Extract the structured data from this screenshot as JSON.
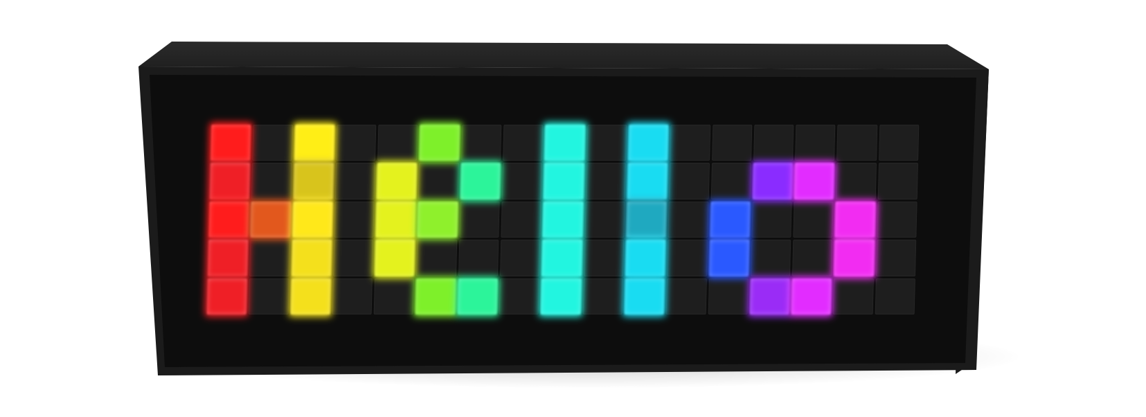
{
  "sign": {
    "grid": {
      "columns": 17,
      "rows": 5
    },
    "body_color": "#1a1a1a",
    "face_color": "#0d0d0d",
    "off_pixel_color": "#1e1e1e",
    "lit_pixels": [
      {
        "col": 0,
        "row": 0,
        "color": "#ff1c1c"
      },
      {
        "col": 0,
        "row": 1,
        "color": "#ef1f26"
      },
      {
        "col": 0,
        "row": 2,
        "color": "#ff1c1c"
      },
      {
        "col": 0,
        "row": 3,
        "color": "#ef1f26"
      },
      {
        "col": 0,
        "row": 4,
        "color": "#ef1f26"
      },
      {
        "col": 1,
        "row": 2,
        "color": "#e2581d"
      },
      {
        "col": 2,
        "row": 0,
        "color": "#ffee16"
      },
      {
        "col": 2,
        "row": 1,
        "color": "#d8c41c"
      },
      {
        "col": 2,
        "row": 2,
        "color": "#ffe81a"
      },
      {
        "col": 2,
        "row": 3,
        "color": "#f4e01c"
      },
      {
        "col": 2,
        "row": 4,
        "color": "#f4e01c"
      },
      {
        "col": 4,
        "row": 1,
        "color": "#e4f21e"
      },
      {
        "col": 4,
        "row": 2,
        "color": "#e4f21e"
      },
      {
        "col": 4,
        "row": 3,
        "color": "#e4f21e"
      },
      {
        "col": 5,
        "row": 0,
        "color": "#7ef02a"
      },
      {
        "col": 5,
        "row": 2,
        "color": "#8ff02c"
      },
      {
        "col": 5,
        "row": 4,
        "color": "#7ef02a"
      },
      {
        "col": 6,
        "row": 1,
        "color": "#2cf49a"
      },
      {
        "col": 6,
        "row": 4,
        "color": "#2cf49a"
      },
      {
        "col": 8,
        "row": 0,
        "color": "#22f5e0"
      },
      {
        "col": 8,
        "row": 1,
        "color": "#22f5e0"
      },
      {
        "col": 8,
        "row": 2,
        "color": "#22f5e0"
      },
      {
        "col": 8,
        "row": 3,
        "color": "#22f5e0"
      },
      {
        "col": 8,
        "row": 4,
        "color": "#22f5e0"
      },
      {
        "col": 10,
        "row": 0,
        "color": "#19dcf2"
      },
      {
        "col": 10,
        "row": 1,
        "color": "#19dcf2"
      },
      {
        "col": 10,
        "row": 2,
        "color": "#1fa9c0"
      },
      {
        "col": 10,
        "row": 3,
        "color": "#19dcf2"
      },
      {
        "col": 10,
        "row": 4,
        "color": "#19dcf2"
      },
      {
        "col": 12,
        "row": 2,
        "color": "#2a59ff"
      },
      {
        "col": 12,
        "row": 3,
        "color": "#2a59ff"
      },
      {
        "col": 13,
        "row": 1,
        "color": "#8a2cff"
      },
      {
        "col": 13,
        "row": 4,
        "color": "#9a2cf6"
      },
      {
        "col": 14,
        "row": 1,
        "color": "#e22cff"
      },
      {
        "col": 14,
        "row": 4,
        "color": "#e22cff"
      },
      {
        "col": 15,
        "row": 2,
        "color": "#f22cf2"
      },
      {
        "col": 15,
        "row": 3,
        "color": "#f22cf2"
      }
    ]
  }
}
